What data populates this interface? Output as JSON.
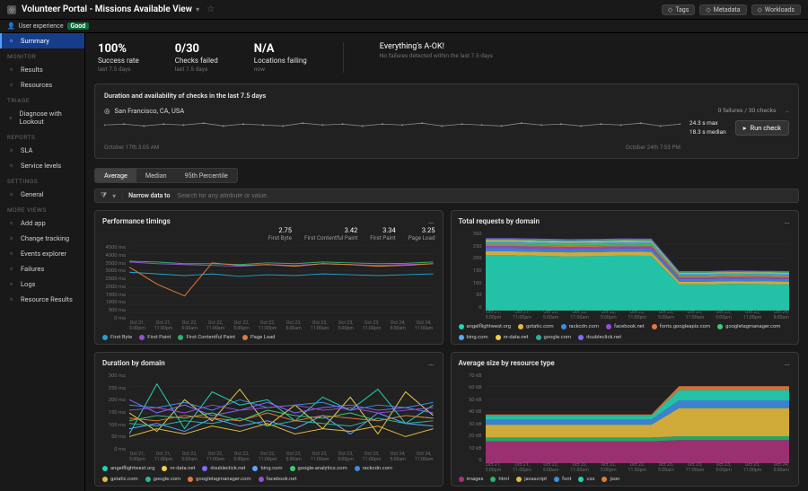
{
  "header": {
    "title": "Volunteer Portal - Missions Available View",
    "pills": [
      {
        "icon": "tag-icon",
        "label": "Tags"
      },
      {
        "icon": "metadata-icon",
        "label": "Metadata"
      },
      {
        "icon": "workloads-icon",
        "label": "Workloads"
      }
    ]
  },
  "subheader": {
    "ux_label": "User experience",
    "ux_badge": "Good"
  },
  "sidebar": {
    "items": [
      {
        "section": null,
        "icon": "summary-icon",
        "label": "Summary",
        "selected": true
      },
      {
        "section": "MONITOR"
      },
      {
        "icon": "results-icon",
        "label": "Results"
      },
      {
        "icon": "resources-icon",
        "label": "Resources"
      },
      {
        "section": "TRIAGE"
      },
      {
        "icon": "diagnose-icon",
        "label": "Diagnose with Lookout"
      },
      {
        "section": "REPORTS"
      },
      {
        "icon": "sla-icon",
        "label": "SLA"
      },
      {
        "icon": "service-levels-icon",
        "label": "Service levels"
      },
      {
        "section": "SETTINGS"
      },
      {
        "icon": "settings-icon",
        "label": "General"
      },
      {
        "section": "MORE VIEWS"
      },
      {
        "icon": "add-app-icon",
        "label": "Add app"
      },
      {
        "icon": "change-tracking-icon",
        "label": "Change tracking"
      },
      {
        "icon": "events-explorer-icon",
        "label": "Events explorer"
      },
      {
        "icon": "failures-icon",
        "label": "Failures"
      },
      {
        "icon": "logs-icon",
        "label": "Logs"
      },
      {
        "icon": "resource-results-icon",
        "label": "Resource Results"
      }
    ]
  },
  "summary_metrics": [
    {
      "value": "100%",
      "label": "Success rate",
      "sub": "last 7.5 days"
    },
    {
      "value": "0/30",
      "label": "Checks failed",
      "sub": "last 7.5 days"
    },
    {
      "value": "N/A",
      "label": "Locations failing",
      "sub": "now"
    }
  ],
  "status": {
    "title": "Everything's A-OK!",
    "sub": "No failures detected within the last 7.5 days"
  },
  "check_panel": {
    "title": "Duration and availability of checks in the last 7.5 days",
    "location": "San Francisco, CA, USA",
    "failures": "0 failures / 30 checks",
    "max": "24.3 s max",
    "median": "18.3 s median",
    "run_label": "Run check",
    "axis_left": "October 17th 3:05 AM",
    "axis_right": "October 24th 7:53 PM"
  },
  "tabs": [
    "Average",
    "Median",
    "95th Percentile"
  ],
  "active_tab": 0,
  "filter": {
    "narrow": "Narrow data to",
    "placeholder": "Search for any attribute or value."
  },
  "colors": {
    "perf": {
      "first_byte": "#1fa3d1",
      "first_paint": "#9b4dd6",
      "first_contentful_paint": "#2bb36e",
      "page_load": "#e27a3b"
    },
    "domains": {
      "angelflightwest.org": "#24d3b5",
      "gstatic.com": "#e2b93b",
      "rackcdn.com": "#3f8de0",
      "facebook.net": "#9b4dd6",
      "fonts.googleapis.com": "#e27a3b",
      "googletagmanager.com": "#3ccf6e",
      "bing.com": "#5aa7ff",
      "nr-data.net": "#f2d04a",
      "google.com": "#2bb3a0",
      "doubleclick.net": "#7e6cff"
    },
    "resources": {
      "images": "#a83279",
      "html": "#2bb36e",
      "javascript": "#e2b93b",
      "font": "#3f8de0",
      "css": "#24d3b5",
      "json": "#e27a3b"
    }
  },
  "x_ticks": [
    "Oct 21,\n5:00pm",
    "Oct 21,\n11:00pm",
    "Oct 22,\n5:00am",
    "Oct 22,\n11:00am",
    "Oct 22,\n5:00pm",
    "Oct 22,\n11:00pm",
    "Oct 23,\n5:00am",
    "Oct 23,\n11:00am",
    "Oct 23,\n5:00pm",
    "Oct 23,\n11:00pm",
    "Oct 24,\n5:00am",
    "Oct 24,\n11:00am"
  ],
  "x_ticks_req": [
    "Oct 21,\n5:00pm",
    "Oct 21,\n11:00pm",
    "Oct 22,\n5:00am",
    "Oct 22,\n11:00am",
    "Oct 22,\n5:00pm",
    "Oct 22,\n11:00pm",
    "Oct 23,\n5:00am",
    "Oct 23,\n11:00am",
    "Oct 23,\n5:00pm",
    "Oct 23,\n11:00pm",
    "Oct 24,\n5:00am"
  ],
  "chart_data": [
    {
      "id": "perf",
      "title": "Performance timings",
      "type": "line",
      "ylabel": "ms",
      "yticks": [
        "4500 ms",
        "4000 ms",
        "3500 ms",
        "3000 ms",
        "2500 ms",
        "2000 ms",
        "1500 ms",
        "1000 ms",
        "500 ms",
        "0 ms"
      ],
      "ylim": [
        0,
        4500
      ],
      "metrics": [
        {
          "label": "First Byte",
          "value": "2.75"
        },
        {
          "label": "First Contentful Paint",
          "value": "3.42"
        },
        {
          "label": "First Paint",
          "value": "3.34"
        },
        {
          "label": "Page Load",
          "value": "3.25"
        }
      ],
      "series": [
        {
          "name": "First Byte",
          "color": "#1fa3d1",
          "values": [
            2900,
            2800,
            2700,
            2800,
            2650,
            2750,
            2700,
            2800,
            2750,
            2700,
            2750,
            2800
          ]
        },
        {
          "name": "First Paint",
          "color": "#9b4dd6",
          "values": [
            3500,
            3400,
            3350,
            3300,
            3250,
            3350,
            3300,
            3400,
            3350,
            3300,
            3350,
            3400
          ]
        },
        {
          "name": "First Contentful Paint",
          "color": "#2bb36e",
          "values": [
            3550,
            3500,
            3400,
            3400,
            3350,
            3450,
            3400,
            3500,
            3450,
            3400,
            3420,
            3500
          ]
        },
        {
          "name": "Page Load",
          "color": "#e27a3b",
          "values": [
            3200,
            2200,
            1500,
            3450,
            3300,
            3350,
            3250,
            3400,
            3350,
            3250,
            3300,
            3400
          ]
        }
      ]
    },
    {
      "id": "req",
      "title": "Total requests by domain",
      "type": "area",
      "ylabel": "",
      "yticks": [
        "300",
        "250",
        "200",
        "150",
        "100",
        "50",
        "0"
      ],
      "ylim": [
        0,
        300
      ],
      "series": [
        {
          "name": "angelflightwest.org",
          "color": "#24d3b5",
          "values": [
            210,
            210,
            208,
            206,
            207,
            209,
            208,
            100,
            100,
            102,
            101,
            100
          ]
        },
        {
          "name": "gstatic.com",
          "color": "#e2b93b",
          "values": [
            15,
            15,
            15,
            15,
            15,
            15,
            15,
            10,
            10,
            10,
            10,
            10
          ]
        },
        {
          "name": "rackcdn.com",
          "color": "#3f8de0",
          "values": [
            12,
            12,
            12,
            12,
            12,
            12,
            12,
            10,
            10,
            10,
            10,
            10
          ]
        },
        {
          "name": "facebook.net",
          "color": "#9b4dd6",
          "values": [
            8,
            8,
            8,
            8,
            8,
            8,
            8,
            6,
            6,
            6,
            6,
            6
          ]
        },
        {
          "name": "fonts.googleapis.com",
          "color": "#e27a3b",
          "values": [
            6,
            6,
            6,
            6,
            6,
            6,
            6,
            5,
            5,
            5,
            5,
            5
          ]
        },
        {
          "name": "googletagmanager.com",
          "color": "#3ccf6e",
          "values": [
            6,
            6,
            6,
            6,
            6,
            6,
            6,
            5,
            5,
            5,
            5,
            5
          ]
        },
        {
          "name": "bing.com",
          "color": "#5aa7ff",
          "values": [
            5,
            5,
            5,
            5,
            5,
            5,
            5,
            4,
            4,
            4,
            4,
            4
          ]
        },
        {
          "name": "nr-data.net",
          "color": "#f2d04a",
          "values": [
            5,
            5,
            5,
            5,
            5,
            5,
            5,
            4,
            4,
            4,
            4,
            4
          ]
        },
        {
          "name": "google.com",
          "color": "#2bb3a0",
          "values": [
            4,
            4,
            4,
            4,
            4,
            4,
            4,
            3,
            3,
            3,
            3,
            3
          ]
        },
        {
          "name": "doubleclick.net",
          "color": "#7e6cff",
          "values": [
            4,
            4,
            4,
            4,
            4,
            4,
            4,
            3,
            3,
            3,
            3,
            3
          ]
        }
      ]
    },
    {
      "id": "dur",
      "title": "Duration by domain",
      "type": "line",
      "ylabel": "ms",
      "yticks": [
        "300 ms",
        "250 ms",
        "200 ms",
        "150 ms",
        "100 ms",
        "50 ms",
        "0 ms"
      ],
      "ylim": [
        0,
        300
      ],
      "series": [
        {
          "name": "angelflightwest.org",
          "color": "#24d3b5",
          "values": [
            70,
            260,
            90,
            230,
            180,
            200,
            120,
            210,
            160,
            240,
            110,
            180
          ]
        },
        {
          "name": "nr-data.net",
          "color": "#f2d04a",
          "values": [
            150,
            80,
            200,
            120,
            240,
            100,
            180,
            90,
            210,
            70,
            230,
            140
          ]
        },
        {
          "name": "doubleclick.net",
          "color": "#7e6cff",
          "values": [
            200,
            150,
            180,
            140,
            160,
            190,
            150,
            170,
            180,
            160,
            170,
            150
          ]
        },
        {
          "name": "bing.com",
          "color": "#5aa7ff",
          "values": [
            90,
            110,
            80,
            130,
            100,
            120,
            90,
            140,
            70,
            150,
            110,
            100
          ]
        },
        {
          "name": "google-analytics.com",
          "color": "#3ccf6e",
          "values": [
            120,
            140,
            130,
            150,
            120,
            160,
            140,
            130,
            150,
            120,
            140,
            130
          ]
        },
        {
          "name": "rackcdn.com",
          "color": "#3f8de0",
          "values": [
            180,
            170,
            190,
            160,
            200,
            170,
            180,
            190,
            160,
            180,
            170,
            190
          ]
        },
        {
          "name": "gstatic.com",
          "color": "#e2b93b",
          "values": [
            60,
            90,
            70,
            100,
            80,
            110,
            70,
            90,
            80,
            100,
            60,
            90
          ]
        },
        {
          "name": "google.com",
          "color": "#2bb3a0",
          "values": [
            110,
            100,
            120,
            110,
            130,
            100,
            120,
            110,
            100,
            130,
            110,
            120
          ]
        },
        {
          "name": "googletagmanager.com",
          "color": "#e27a3b",
          "values": [
            130,
            120,
            140,
            130,
            120,
            150,
            120,
            140,
            130,
            120,
            140,
            130
          ]
        },
        {
          "name": "facebook.net",
          "color": "#9b4dd6",
          "values": [
            160,
            170,
            150,
            180,
            160,
            170,
            180,
            160,
            170,
            150,
            160,
            170
          ]
        }
      ]
    },
    {
      "id": "size",
      "title": "Average size by resource type",
      "type": "area",
      "ylabel": "kB",
      "yticks": [
        "70 kB",
        "60 kB",
        "50 kB",
        "40 kB",
        "30 kB",
        "20 kB",
        "10 kB",
        "0"
      ],
      "ylim": [
        0,
        70
      ],
      "series": [
        {
          "name": "images",
          "color": "#a83279",
          "values": [
            17,
            17,
            17,
            17,
            17,
            17,
            17,
            18,
            18,
            18,
            18,
            18
          ]
        },
        {
          "name": "html",
          "color": "#2bb36e",
          "values": [
            3,
            3,
            3,
            3,
            3,
            3,
            3,
            3,
            3,
            3,
            3,
            3
          ]
        },
        {
          "name": "javascript",
          "color": "#e2b93b",
          "values": [
            10,
            10,
            10,
            10,
            10,
            10,
            10,
            22,
            22,
            22,
            22,
            22
          ]
        },
        {
          "name": "font",
          "color": "#3f8de0",
          "values": [
            4,
            4,
            4,
            4,
            4,
            4,
            4,
            6,
            6,
            6,
            6,
            6
          ]
        },
        {
          "name": "css",
          "color": "#24d3b5",
          "values": [
            3,
            3,
            3,
            3,
            3,
            3,
            3,
            8,
            8,
            8,
            8,
            8
          ]
        },
        {
          "name": "json",
          "color": "#e27a3b",
          "values": [
            1,
            1,
            1,
            1,
            1,
            1,
            1,
            3,
            3,
            3,
            3,
            3
          ]
        }
      ]
    }
  ],
  "spark": {
    "values": [
      18,
      19,
      17,
      19,
      18,
      20,
      17,
      19,
      18,
      17,
      20,
      18,
      19,
      17,
      19,
      18,
      20,
      17,
      19,
      18,
      17,
      20,
      18,
      19,
      17,
      19,
      18,
      20,
      17,
      19
    ],
    "ylim": [
      0,
      25
    ]
  }
}
